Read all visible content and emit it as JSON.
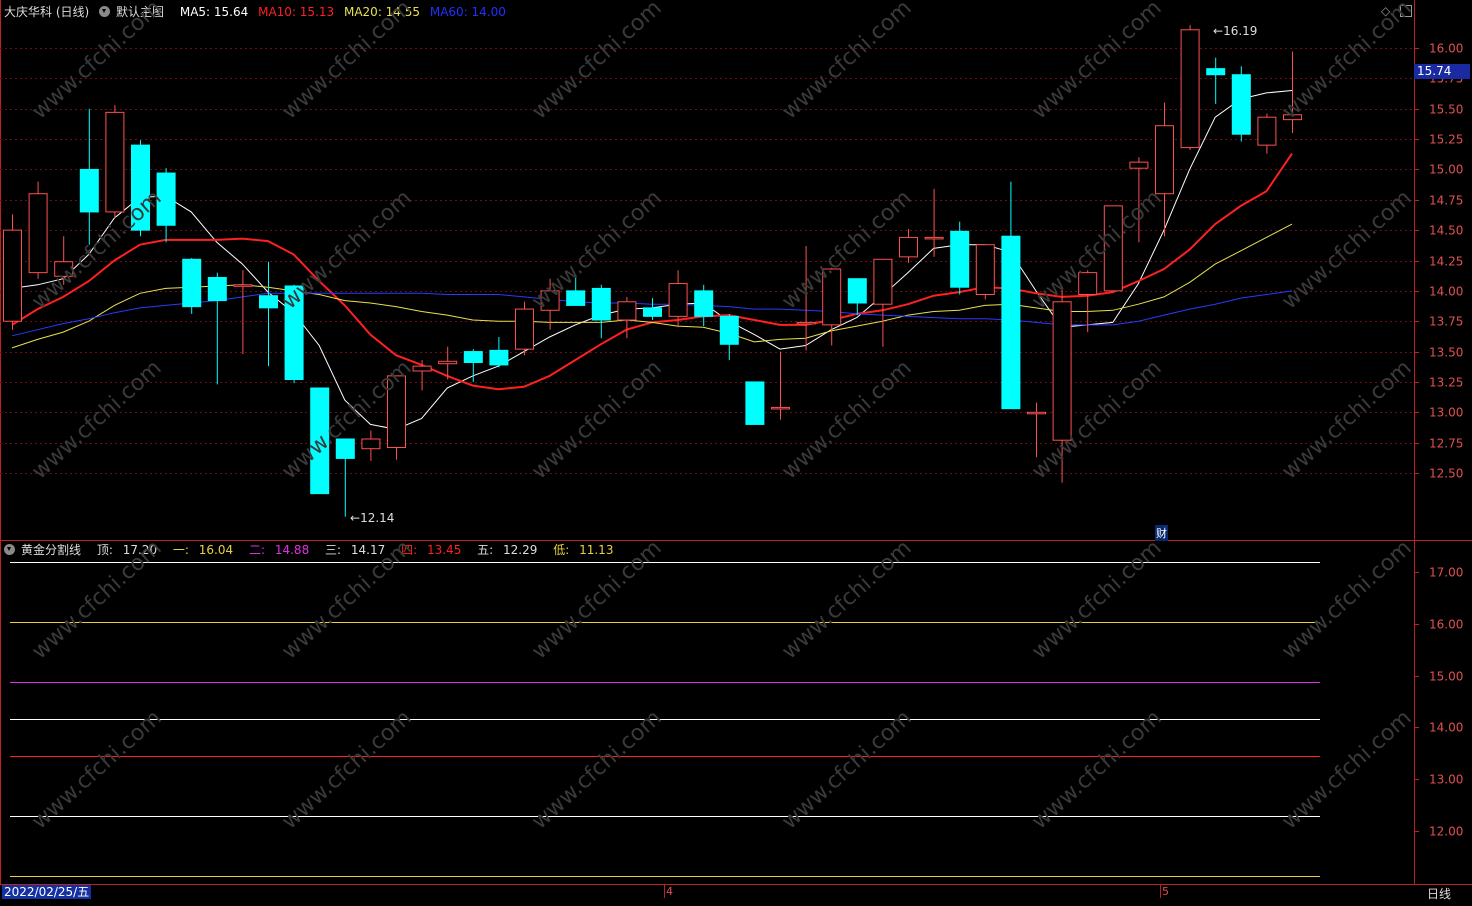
{
  "header": {
    "stock_title": "大庆华科 (日线)",
    "main_chart_label": "默认主图",
    "ma5": "MA5: 15.64",
    "ma10": "MA10: 15.13",
    "ma20": "MA20: 14.55",
    "ma60": "MA60: 14.00",
    "colors": {
      "ma5": "#ffffff",
      "ma10": "#ff2020",
      "ma20": "#e8e050",
      "ma60": "#2030ff"
    }
  },
  "price_panel": {
    "current_price_tag": "15.74",
    "high_marker": "16.19",
    "low_marker": "12.14",
    "finance_badge": "财",
    "y_ticks": [
      "16.00",
      "15.75",
      "15.50",
      "15.25",
      "15.00",
      "14.75",
      "14.50",
      "14.25",
      "14.00",
      "13.75",
      "13.50",
      "13.25",
      "13.00",
      "12.75",
      "12.50"
    ]
  },
  "golden_panel": {
    "title": "黄金分割线",
    "top_label": "顶:",
    "top_value": "17.20",
    "l1_label": "一:",
    "l1_value": "16.04",
    "l2_label": "二:",
    "l2_value": "14.88",
    "l3_label": "三:",
    "l3_value": "14.17",
    "l4_label": "四:",
    "l4_value": "13.45",
    "l5_label": "五:",
    "l5_value": "12.29",
    "low_label": "低:",
    "low_value": "11.13",
    "y_ticks": [
      "17.00",
      "16.00",
      "15.00",
      "14.00",
      "13.00",
      "12.00"
    ]
  },
  "footer": {
    "date": "2022/02/25/五",
    "month_4": "4",
    "month_5": "5",
    "period": "日线"
  },
  "watermark": "www.cfchi.com",
  "chart_data": {
    "type": "candlestick",
    "ylim": [
      12.0,
      16.3
    ],
    "candles": [
      {
        "o": 13.75,
        "h": 14.63,
        "l": 13.68,
        "c": 14.5
      },
      {
        "o": 14.15,
        "h": 14.9,
        "l": 14.1,
        "c": 14.8
      },
      {
        "o": 14.12,
        "h": 14.45,
        "l": 14.05,
        "c": 14.24
      },
      {
        "o": 15.0,
        "h": 15.5,
        "l": 14.38,
        "c": 14.65
      },
      {
        "o": 14.65,
        "h": 15.53,
        "l": 14.6,
        "c": 15.47
      },
      {
        "o": 15.2,
        "h": 15.24,
        "l": 14.45,
        "c": 14.5
      },
      {
        "o": 14.97,
        "h": 15.01,
        "l": 14.4,
        "c": 14.54
      },
      {
        "o": 14.26,
        "h": 14.27,
        "l": 13.81,
        "c": 13.87
      },
      {
        "o": 14.11,
        "h": 14.15,
        "l": 13.23,
        "c": 13.92
      },
      {
        "o": 14.05,
        "h": 14.17,
        "l": 13.48,
        "c": 14.05
      },
      {
        "o": 13.96,
        "h": 14.24,
        "l": 13.38,
        "c": 13.86
      },
      {
        "o": 14.04,
        "h": 14.05,
        "l": 13.24,
        "c": 13.27
      },
      {
        "o": 13.2,
        "h": 13.2,
        "l": 12.37,
        "c": 12.33
      },
      {
        "o": 12.78,
        "h": 12.78,
        "l": 12.14,
        "c": 12.62
      },
      {
        "o": 12.7,
        "h": 12.85,
        "l": 12.6,
        "c": 12.78
      },
      {
        "o": 12.71,
        "h": 13.3,
        "l": 12.61,
        "c": 13.3
      },
      {
        "o": 13.34,
        "h": 13.43,
        "l": 13.18,
        "c": 13.38
      },
      {
        "o": 13.4,
        "h": 13.54,
        "l": 13.27,
        "c": 13.42
      },
      {
        "o": 13.5,
        "h": 13.52,
        "l": 13.25,
        "c": 13.41
      },
      {
        "o": 13.51,
        "h": 13.62,
        "l": 13.37,
        "c": 13.39
      },
      {
        "o": 13.52,
        "h": 13.91,
        "l": 13.47,
        "c": 13.85
      },
      {
        "o": 13.84,
        "h": 14.1,
        "l": 13.68,
        "c": 14.0
      },
      {
        "o": 14.0,
        "h": 14.12,
        "l": 13.88,
        "c": 13.88
      },
      {
        "o": 14.02,
        "h": 14.05,
        "l": 13.61,
        "c": 13.76
      },
      {
        "o": 13.76,
        "h": 13.95,
        "l": 13.61,
        "c": 13.91
      },
      {
        "o": 13.86,
        "h": 13.94,
        "l": 13.76,
        "c": 13.79
      },
      {
        "o": 13.79,
        "h": 14.17,
        "l": 13.7,
        "c": 14.06
      },
      {
        "o": 14.0,
        "h": 14.05,
        "l": 13.71,
        "c": 13.79
      },
      {
        "o": 13.79,
        "h": 13.81,
        "l": 13.43,
        "c": 13.56
      },
      {
        "o": 13.25,
        "h": 13.25,
        "l": 12.95,
        "c": 12.9
      },
      {
        "o": 13.04,
        "h": 13.5,
        "l": 12.94,
        "c": 13.04
      },
      {
        "o": 13.74,
        "h": 14.37,
        "l": 13.51,
        "c": 13.74
      },
      {
        "o": 13.72,
        "h": 14.19,
        "l": 13.55,
        "c": 14.18
      },
      {
        "o": 14.1,
        "h": 14.1,
        "l": 13.8,
        "c": 13.9
      },
      {
        "o": 13.89,
        "h": 14.26,
        "l": 13.54,
        "c": 14.26
      },
      {
        "o": 14.28,
        "h": 14.51,
        "l": 14.23,
        "c": 14.44
      },
      {
        "o": 14.44,
        "h": 14.84,
        "l": 14.28,
        "c": 14.44
      },
      {
        "o": 14.49,
        "h": 14.57,
        "l": 13.97,
        "c": 14.03
      },
      {
        "o": 13.97,
        "h": 14.38,
        "l": 13.93,
        "c": 14.38
      },
      {
        "o": 14.45,
        "h": 14.9,
        "l": 13.03,
        "c": 13.03
      },
      {
        "o": 12.99,
        "h": 13.08,
        "l": 12.63,
        "c": 13.0
      },
      {
        "o": 12.77,
        "h": 14.01,
        "l": 12.42,
        "c": 13.91
      },
      {
        "o": 13.97,
        "h": 14.17,
        "l": 13.66,
        "c": 14.15
      },
      {
        "o": 14.0,
        "h": 14.7,
        "l": 14.0,
        "c": 14.7
      },
      {
        "o": 15.01,
        "h": 15.1,
        "l": 14.4,
        "c": 15.06
      },
      {
        "o": 14.8,
        "h": 15.55,
        "l": 14.45,
        "c": 15.36
      },
      {
        "o": 15.18,
        "h": 16.19,
        "l": 15.16,
        "c": 16.15
      },
      {
        "o": 15.83,
        "h": 15.92,
        "l": 15.54,
        "c": 15.78
      },
      {
        "o": 15.78,
        "h": 15.85,
        "l": 15.23,
        "c": 15.29
      },
      {
        "o": 15.2,
        "h": 15.46,
        "l": 15.13,
        "c": 15.43
      },
      {
        "o": 15.41,
        "h": 15.97,
        "l": 15.3,
        "c": 15.45
      }
    ],
    "series": [
      {
        "name": "MA5",
        "values": [
          14.02,
          14.05,
          14.1,
          14.3,
          14.6,
          14.77,
          14.78,
          14.65,
          14.4,
          14.22,
          13.99,
          13.82,
          13.55,
          13.1,
          12.9,
          12.86,
          12.95,
          13.2,
          13.3,
          13.38,
          13.5,
          13.62,
          13.72,
          13.8,
          13.85,
          13.86,
          13.89,
          13.9,
          13.75,
          13.64,
          13.52,
          13.55,
          13.68,
          13.78,
          13.96,
          14.15,
          14.35,
          14.38,
          14.38,
          14.32,
          14.0,
          13.7,
          13.72,
          13.74,
          14.06,
          14.5,
          15.0,
          15.43,
          15.58,
          15.63,
          15.65
        ]
      },
      {
        "name": "MA10",
        "values": [
          13.72,
          13.85,
          13.95,
          14.08,
          14.25,
          14.38,
          14.42,
          14.42,
          14.42,
          14.43,
          14.41,
          14.3,
          14.08,
          13.88,
          13.64,
          13.47,
          13.39,
          13.3,
          13.22,
          13.19,
          13.21,
          13.3,
          13.43,
          13.56,
          13.68,
          13.74,
          13.76,
          13.79,
          13.8,
          13.76,
          13.72,
          13.72,
          13.76,
          13.81,
          13.84,
          13.89,
          13.96,
          13.99,
          14.03,
          14.02,
          13.98,
          13.95,
          13.96,
          13.99,
          14.08,
          14.18,
          14.34,
          14.55,
          14.7,
          14.82,
          15.13
        ]
      },
      {
        "name": "MA20",
        "values": [
          13.53,
          13.6,
          13.66,
          13.75,
          13.88,
          13.98,
          14.02,
          14.03,
          14.04,
          14.05,
          14.03,
          14.0,
          13.97,
          13.92,
          13.9,
          13.87,
          13.83,
          13.8,
          13.76,
          13.75,
          13.75,
          13.74,
          13.74,
          13.74,
          13.76,
          13.74,
          13.71,
          13.7,
          13.65,
          13.58,
          13.6,
          13.61,
          13.67,
          13.71,
          13.75,
          13.8,
          13.83,
          13.84,
          13.88,
          13.89,
          13.86,
          13.83,
          13.83,
          13.84,
          13.89,
          13.95,
          14.07,
          14.22,
          14.33,
          14.44,
          14.55
        ]
      },
      {
        "name": "MA60",
        "values": [
          13.63,
          13.68,
          13.73,
          13.77,
          13.82,
          13.86,
          13.88,
          13.9,
          13.92,
          13.95,
          13.98,
          13.98,
          13.98,
          13.98,
          13.98,
          13.98,
          13.98,
          13.97,
          13.97,
          13.97,
          13.95,
          13.93,
          13.91,
          13.9,
          13.9,
          13.89,
          13.89,
          13.88,
          13.87,
          13.85,
          13.85,
          13.84,
          13.83,
          13.81,
          13.8,
          13.79,
          13.78,
          13.77,
          13.77,
          13.76,
          13.74,
          13.72,
          13.72,
          13.72,
          13.75,
          13.8,
          13.85,
          13.89,
          13.94,
          13.97,
          14.0
        ]
      }
    ],
    "golden_levels": [
      {
        "name": "顶",
        "value": 17.2,
        "color": "#ffffff"
      },
      {
        "name": "一",
        "value": 16.04,
        "color": "#e8d040"
      },
      {
        "name": "二",
        "value": 14.88,
        "color": "#e030e0"
      },
      {
        "name": "三",
        "value": 14.17,
        "color": "#ffffff"
      },
      {
        "name": "四",
        "value": 13.45,
        "color": "#ff2020"
      },
      {
        "name": "五",
        "value": 12.29,
        "color": "#ffffff"
      },
      {
        "name": "低",
        "value": 11.13,
        "color": "#e8d040"
      }
    ],
    "golden_ylim": [
      11.0,
      17.6
    ]
  }
}
